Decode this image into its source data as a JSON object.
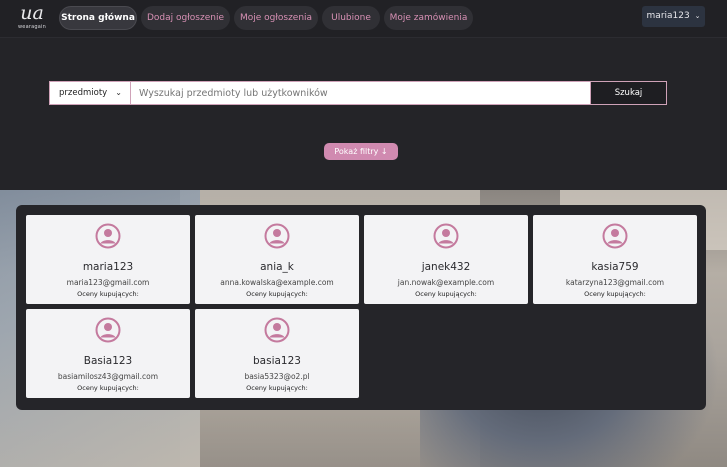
{
  "logo": {
    "mark": "ua",
    "text": "wearagain"
  },
  "nav": [
    {
      "label": "Strona główna",
      "active": true
    },
    {
      "label": "Dodaj ogłoszenie",
      "active": false
    },
    {
      "label": "Moje ogłoszenia",
      "active": false
    },
    {
      "label": "Ulubione",
      "active": false
    },
    {
      "label": "Moje zamówienia",
      "active": false
    }
  ],
  "user_menu": {
    "label": "maria123",
    "icon": "chevron-down-icon"
  },
  "search": {
    "category": "przedmioty",
    "placeholder": "Wyszukaj przedmioty lub użytkowników",
    "button": "Szukaj"
  },
  "filters_button": "Pokaż filtry ↓",
  "colors": {
    "accent": "#d08ab0",
    "background": "#242428",
    "card": "#f3f3f5"
  },
  "users": [
    {
      "username": "maria123",
      "email": "maria123@gmail.com",
      "ratings_label": "Oceny kupujących:",
      "icon": "user-avatar-icon"
    },
    {
      "username": "ania_k",
      "email": "anna.kowalska@example.com",
      "ratings_label": "Oceny kupujących:",
      "icon": "user-avatar-icon"
    },
    {
      "username": "janek432",
      "email": "jan.nowak@example.com",
      "ratings_label": "Oceny kupujących:",
      "icon": "user-avatar-icon"
    },
    {
      "username": "kasia759",
      "email": "katarzyna123@gmail.com",
      "ratings_label": "Oceny kupujących:",
      "icon": "user-avatar-icon"
    },
    {
      "username": "Basia123",
      "email": "basiamilosz43@gmail.com",
      "ratings_label": "Oceny kupujących:",
      "icon": "user-avatar-icon"
    },
    {
      "username": "basia123",
      "email": "basia5323@o2.pl",
      "ratings_label": "Oceny kupujących:",
      "icon": "user-avatar-icon"
    }
  ]
}
